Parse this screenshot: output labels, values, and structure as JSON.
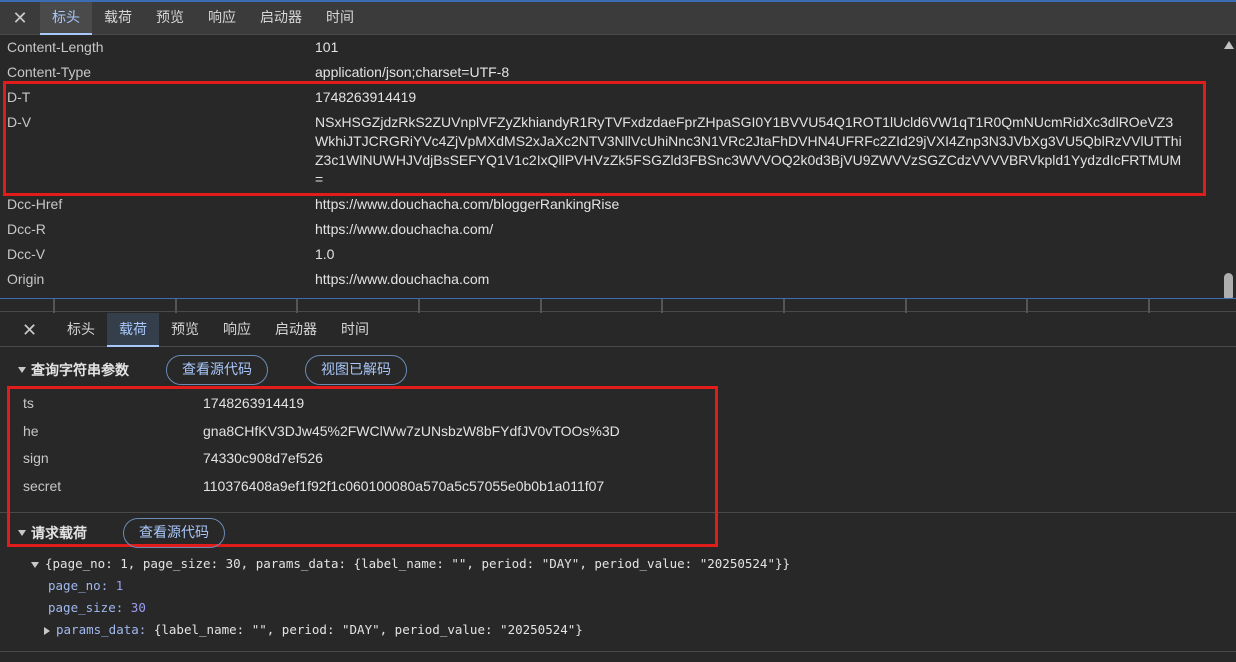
{
  "top_panel": {
    "close_glyph": "✕",
    "tabs": [
      "标头",
      "载荷",
      "预览",
      "响应",
      "启动器",
      "时间"
    ],
    "active_tab": "标头",
    "headers": [
      {
        "name": "Content-Length",
        "value": "101"
      },
      {
        "name": "Content-Type",
        "value": "application/json;charset=UTF-8"
      },
      {
        "name": "D-T",
        "value": "1748263914419"
      },
      {
        "name": "D-V",
        "value": "NSxHSGZjdzRkS2ZUVnplVFZyZkhiandyR1RyTVFxdzdaeFprZHpaSGI0Y1BVVU54Q1ROT1lUcld6VW1qT1R0QmNUcmRidXc3dlROeVZ3WkhiJTJCRGRiYVc4ZjVpMXdMS2xJaXc2NTV3NllVcUhiNnc3N1VRc2JtaFhDVHN4UFRFc2ZId29jVXI4Znp3N3JVbXg3VU5QblRzVVlUTThiZ3c1WlNUWHJVdjBsSEFYQ1V1c2IxQllPVHVzZk5FSGZld3FBSnc3WVVOQ2k0d3BjVU9ZWVVzSGZCdzVVVVBRVkpld1YydzdIcFRTMUM="
      },
      {
        "name": "Dcc-Href",
        "value": "https://www.douchacha.com/bloggerRankingRise"
      },
      {
        "name": "Dcc-R",
        "value": "https://www.douchacha.com/"
      },
      {
        "name": "Dcc-V",
        "value": "1.0"
      },
      {
        "name": "Origin",
        "value": "https://www.douchacha.com"
      }
    ]
  },
  "bottom_panel": {
    "close_glyph": "✕",
    "tabs": [
      "标头",
      "载荷",
      "预览",
      "响应",
      "启动器",
      "时间"
    ],
    "active_tab": "载荷",
    "query_section": {
      "title": "查询字符串参数",
      "view_source_label": "查看源代码",
      "view_decoded_label": "视图已解码",
      "params": [
        {
          "name": "ts",
          "value": "1748263914419"
        },
        {
          "name": "he",
          "value": "gna8CHfKV3DJw45%2FWClWw7zUNsbzW8bFYdfJV0vTOOs%3D"
        },
        {
          "name": "sign",
          "value": "74330c908d7ef526"
        },
        {
          "name": "secret",
          "value": "110376408a9ef1f92f1c060100080a570a5c57055e0b0b1a011f07"
        }
      ]
    },
    "payload_section": {
      "title": "请求载荷",
      "view_source_label": "查看源代码",
      "summary": "{page_no: 1, page_size: 30, params_data: {label_name: \"\", period: \"DAY\", period_value: \"20250524\"}}",
      "fields": [
        {
          "key": "page_no",
          "value": "1"
        },
        {
          "key": "page_size",
          "value": "30"
        }
      ],
      "params_data_key": "params_data",
      "params_data_value": "{label_name: \"\", period: \"DAY\", period_value: \"20250524\"}"
    }
  },
  "colors": {
    "background": "#282828",
    "accent": "#a8c7fa",
    "highlight_box": "#e21b1b",
    "number": "#9b9ef2",
    "key": "#9fb9ee"
  }
}
